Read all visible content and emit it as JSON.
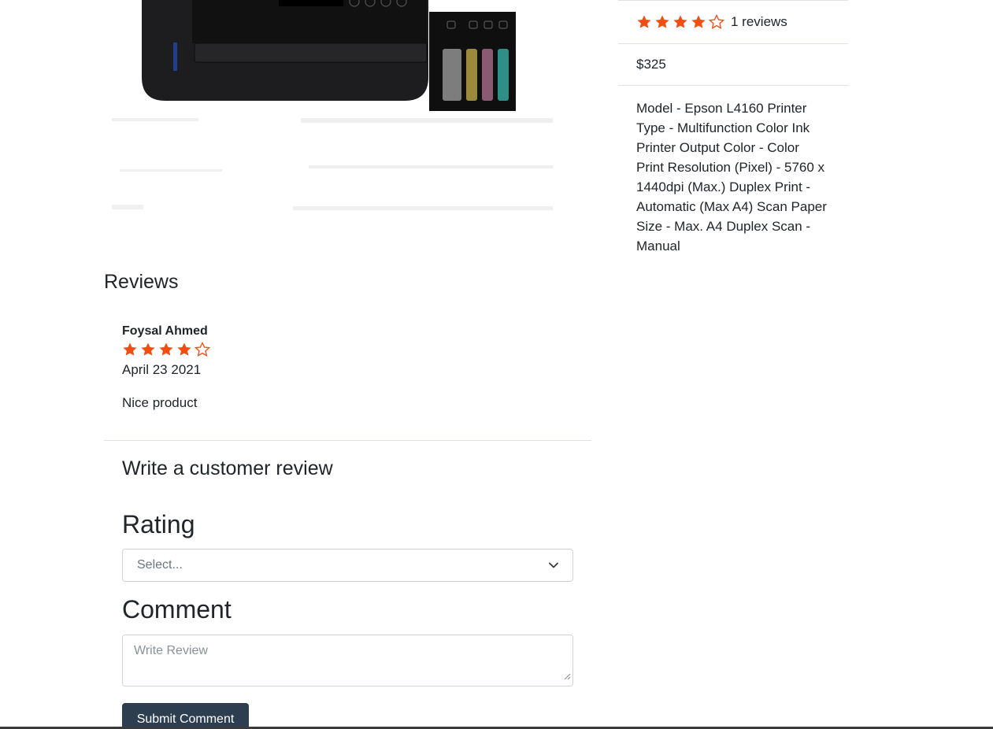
{
  "product": {
    "rating": {
      "value": 4,
      "max": 5
    },
    "reviews_count_label": "1 reviews",
    "price": "$325",
    "description": "Model - Epson L4160 Printer Type - Multifunction Color Ink Printer Output Color - Color Print Resolution (Pixel) - 5760 x 1440dpi (Max.) Duplex Print - Automatic (Max A4) Scan Paper Size - Max. A4 Duplex Scan - Manual"
  },
  "reviews": {
    "heading": "Reviews",
    "items": [
      {
        "name": "Foysal Ahmed",
        "rating": 4,
        "date": "April 23 2021",
        "comment": "Nice product"
      }
    ]
  },
  "review_form": {
    "heading": "Write a customer review",
    "rating_label": "Rating",
    "rating_select_value": "Select...",
    "comment_label": "Comment",
    "comment_placeholder": "Write Review",
    "submit_label": "Submit Comment"
  },
  "colors": {
    "star": "#f04e12",
    "button": "#2c3e50",
    "border": "#dee2e6"
  },
  "icons": {
    "star_filled": "star-filled-icon",
    "star_empty": "star-empty-icon",
    "select_arrow": "chevron-down-icon"
  }
}
